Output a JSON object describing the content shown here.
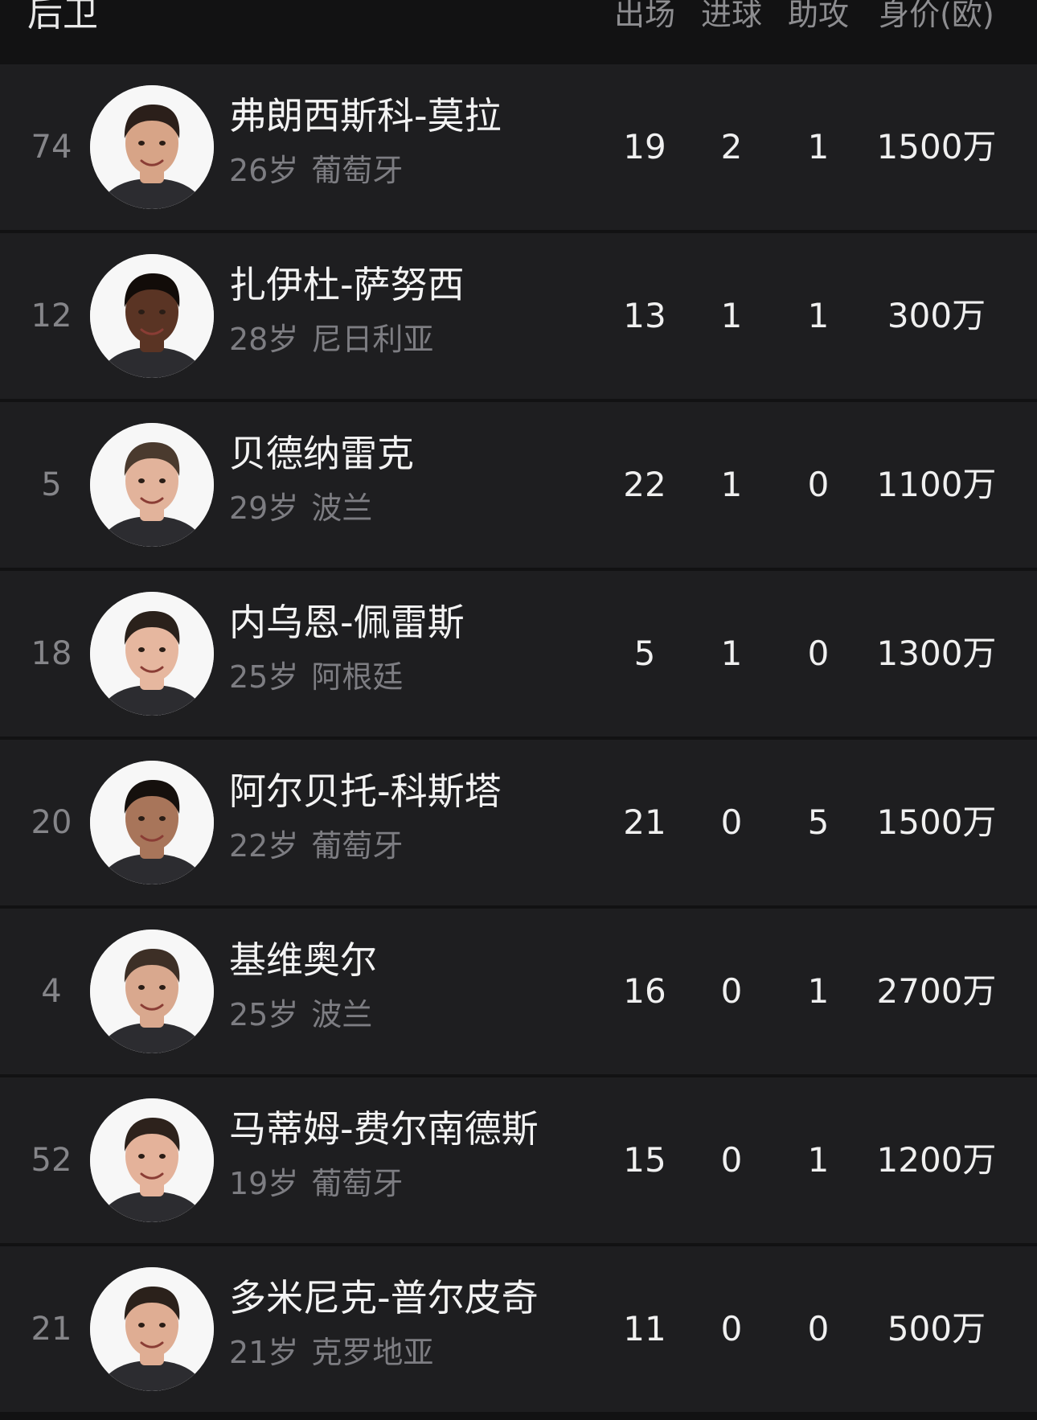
{
  "section": {
    "title": "后卫"
  },
  "columns": {
    "apps": "出场",
    "goals": "进球",
    "assists": "助攻",
    "value": "身价(欧)"
  },
  "players": [
    {
      "number": "74",
      "name": "弗朗西斯科-莫拉",
      "age": "26岁",
      "nationality": "葡萄牙",
      "apps": "19",
      "goals": "2",
      "assists": "1",
      "value": "1500万",
      "skin": "#d7a487",
      "hair": "#2b1f1a"
    },
    {
      "number": "12",
      "name": "扎伊杜-萨努西",
      "age": "28岁",
      "nationality": "尼日利亚",
      "apps": "13",
      "goals": "1",
      "assists": "1",
      "value": "300万",
      "skin": "#5a3424",
      "hair": "#120c09"
    },
    {
      "number": "5",
      "name": "贝德纳雷克",
      "age": "29岁",
      "nationality": "波兰",
      "apps": "22",
      "goals": "1",
      "assists": "0",
      "value": "1100万",
      "skin": "#e2b39b",
      "hair": "#4a3a2e"
    },
    {
      "number": "18",
      "name": "内乌恩-佩雷斯",
      "age": "25岁",
      "nationality": "阿根廷",
      "apps": "5",
      "goals": "1",
      "assists": "0",
      "value": "1300万",
      "skin": "#e6b79f",
      "hair": "#2a211b"
    },
    {
      "number": "20",
      "name": "阿尔贝托-科斯塔",
      "age": "22岁",
      "nationality": "葡萄牙",
      "apps": "21",
      "goals": "0",
      "assists": "5",
      "value": "1500万",
      "skin": "#a8755a",
      "hair": "#15100d"
    },
    {
      "number": "4",
      "name": "基维奥尔",
      "age": "25岁",
      "nationality": "波兰",
      "apps": "16",
      "goals": "0",
      "assists": "1",
      "value": "2700万",
      "skin": "#d9a88e",
      "hair": "#3d2f26"
    },
    {
      "number": "52",
      "name": "马蒂姆-费尔南德斯",
      "age": "19岁",
      "nationality": "葡萄牙",
      "apps": "15",
      "goals": "0",
      "assists": "1",
      "value": "1200万",
      "skin": "#e4b29a",
      "hair": "#2d221c"
    },
    {
      "number": "21",
      "name": "多米尼克-普尔皮奇",
      "age": "21岁",
      "nationality": "克罗地亚",
      "apps": "11",
      "goals": "0",
      "assists": "0",
      "value": "500万",
      "skin": "#dfad93",
      "hair": "#2b211b"
    }
  ]
}
